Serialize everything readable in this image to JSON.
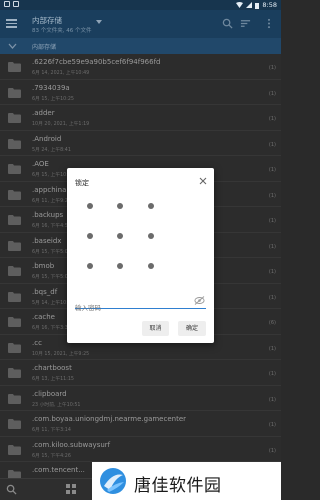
{
  "status_bar": {
    "time": "8:58"
  },
  "toolbar": {
    "title": "内部存储",
    "subtitle": "83 个文件夹, 46 个文件"
  },
  "path_bar": {
    "label": "内部存储"
  },
  "files": [
    {
      "name": ".6226f7cbe59e9a90b5cef6f94f966fd",
      "meta": "6月 14, 2021, 上午10:49",
      "count": "(1)"
    },
    {
      "name": ".7934039a",
      "meta": "6月 15, 上午10:25",
      "count": "(1)"
    },
    {
      "name": ".adder",
      "meta": "10月 20, 2021, 上午1:19",
      "count": "(1)"
    },
    {
      "name": ".Android",
      "meta": "5月 24, 上午8:41",
      "count": "(1)"
    },
    {
      "name": ".AOE",
      "meta": "6月 15, 上午10:54",
      "count": "(1)"
    },
    {
      "name": ".appchina",
      "meta": "6月 11, 上午9:20",
      "count": "(1)"
    },
    {
      "name": ".backups",
      "meta": "6月 16, 下午4:55",
      "count": "(1)"
    },
    {
      "name": ".baseidx",
      "meta": "6月 15, 下午5:03",
      "count": "(1)"
    },
    {
      "name": ".bmob",
      "meta": "6月 15, 下午5:03",
      "count": "(1)"
    },
    {
      "name": ".bqs_df",
      "meta": "5月 14, 上午10:50",
      "count": "(1)"
    },
    {
      "name": ".cache",
      "meta": "6月 16, 下午3:37",
      "count": "(6)"
    },
    {
      "name": ".cc",
      "meta": "10月 15, 2021, 上午9:25",
      "count": "(1)"
    },
    {
      "name": ".chartboost",
      "meta": "6月 13, 上午11:15",
      "count": "(1)"
    },
    {
      "name": ".clipboard",
      "meta": "23 小时前, 上午10:51",
      "count": "(1)"
    },
    {
      "name": ".com.boyaa.uniongdmj.nearme.gamecenter",
      "meta": "6月 11, 下午3:14",
      "count": "(1)"
    },
    {
      "name": ".com.kiloo.subwaysurf",
      "meta": "6月 15, 下午4:26",
      "count": "(1)"
    },
    {
      "name": ".com.tencent...",
      "meta": "",
      "count": ""
    }
  ],
  "dialog": {
    "title": "锁定",
    "password_placeholder": "输入密码",
    "cancel_label": "取消",
    "ok_label": "确定"
  },
  "watermark": {
    "text": "唐佳软件园"
  },
  "colors": {
    "toolbar": "#1a3e5d",
    "path_bar": "#21486a",
    "accent": "#2f7fd0",
    "list_bg": "#2c2c2c"
  }
}
